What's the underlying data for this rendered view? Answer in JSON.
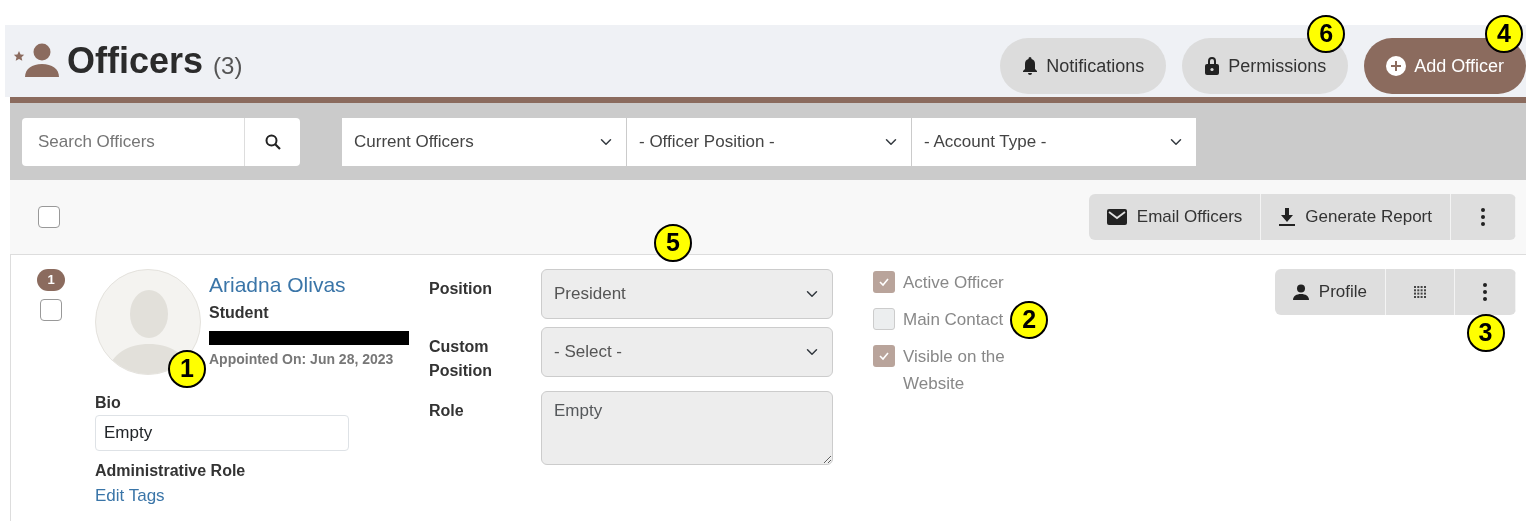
{
  "header": {
    "title": "Officers",
    "count": "(3)",
    "buttons": [
      {
        "kind": "bell",
        "label": "Notifications",
        "primary": false
      },
      {
        "kind": "lock",
        "label": "Permissions",
        "primary": false
      },
      {
        "kind": "plus",
        "label": "Add Officer",
        "primary": true
      }
    ]
  },
  "filters": {
    "search": {
      "placeholder": "Search Officers"
    },
    "selects": [
      "Current Officers",
      "- Officer Position -",
      "- Account Type -"
    ]
  },
  "toolbar": {
    "select_all": {
      "checked": false
    },
    "buttons": [
      {
        "kind": "mail",
        "label": "Email Officers"
      },
      {
        "kind": "download",
        "label": "Generate Report"
      },
      {
        "kind": "more"
      }
    ]
  },
  "officers": [
    {
      "number": "1",
      "selected": false,
      "name": "Ariadna Olivas",
      "account_type": "Student",
      "appointed": "Appointed On: Jun 28, 2023",
      "bio_label": "Bio",
      "bio": "Empty",
      "admin_role_label": "Administrative Role",
      "edit_tags": "Edit Tags",
      "fields": [
        {
          "kind": "select",
          "label": "Position",
          "value": "President"
        },
        {
          "kind": "select",
          "label": "Custom Position",
          "value": "- Select -"
        },
        {
          "kind": "textarea",
          "label": "Role",
          "placeholder": "Empty"
        }
      ],
      "flags": [
        {
          "label": "Active Officer",
          "checked": true
        },
        {
          "label": "Main Contact",
          "checked": false
        },
        {
          "label": "Visible on the Website",
          "checked": true
        }
      ],
      "actions": [
        {
          "kind": "profile",
          "label": "Profile"
        },
        {
          "kind": "grid"
        },
        {
          "kind": "more"
        }
      ]
    }
  ],
  "callouts": [
    "1",
    "2",
    "3",
    "4",
    "5",
    "6"
  ]
}
